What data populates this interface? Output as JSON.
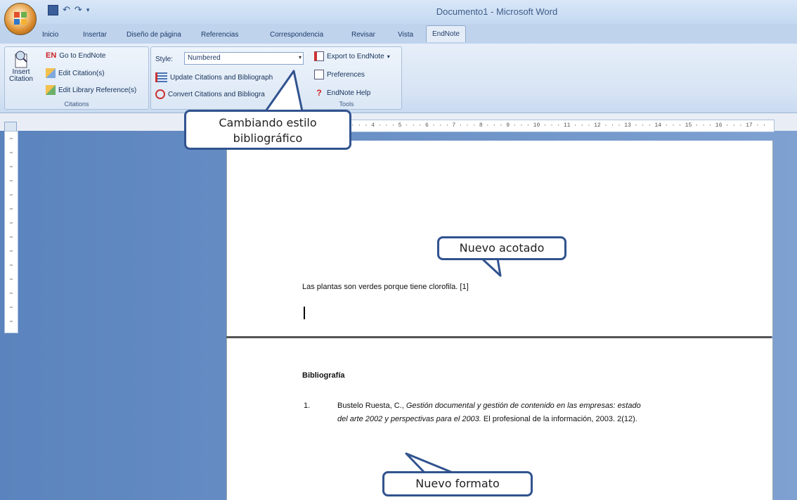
{
  "window": {
    "title": "Documento1 - Microsoft Word"
  },
  "tabs": [
    "Inicio",
    "Insertar",
    "Diseño de página",
    "Referencias",
    "Correspondencia",
    "Revisar",
    "Vista",
    "EndNote"
  ],
  "active_tab": "EndNote",
  "ribbon": {
    "insert_citation": "Insert Citation",
    "go_to_endnote": "Go to EndNote",
    "edit_citations": "Edit Citation(s)",
    "edit_library_reference": "Edit Library Reference(s)",
    "citations_group": "Citations",
    "style_label": "Style:",
    "style_value": "Numbered",
    "update_citations": "Update Citations and Bibliograph",
    "convert_citations": "Convert Citations and Bibliogra",
    "export_to_endnote": "Export to EndNote",
    "preferences": "Preferences",
    "endnote_help": "EndNote Help",
    "tools_group": "Tools"
  },
  "ruler": {
    "ticks": "· · · 3 · · · 4 · · · 5 · · · 6 · · · 7 · · · 8 · · · 9 · · · 10 · · · 11 · · · 12 · · · 13 · · · 14 · · · 15 · · · 16 · · · 17 · ·"
  },
  "document": {
    "sentence": "Las plantas son verdes porque tiene clorofila.",
    "citation": "[1]",
    "bibliography_title": "Bibliografía",
    "entry_number": "1.",
    "entry_line1_plain": "Bustelo Ruesta, C., ",
    "entry_line1_italic": "Gestión documental y gestión de contenido en las empresas: estado",
    "entry_line2_italic": "del arte 2002  y perspectivas para el 2003.",
    "entry_line2_plain": "  El profesional de la información, 2003.  2(12)."
  },
  "callouts": {
    "style_change": [
      "Cambiando estilo",
      "bibliográfico"
    ],
    "new_citation": "Nuevo acotado",
    "new_format": "Nuevo formato"
  },
  "colors": {
    "callout_border": "#31538f",
    "workspace": "#6f95c9"
  }
}
